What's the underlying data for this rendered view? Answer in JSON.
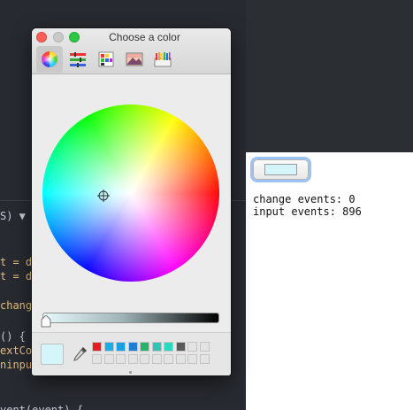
{
  "editor": {
    "lines": [
      {
        "text": "S) ▼",
        "cls": "c-plain"
      },
      {
        "text": "t = do",
        "cls": "c-yellow"
      },
      {
        "text": "t = do",
        "cls": "c-yellow"
      },
      {
        "text": "change",
        "cls": "c-yellow"
      },
      {
        "text": "() {",
        "cls": "c-plain"
      },
      {
        "text": "extCo",
        "cls": "c-yellow"
      },
      {
        "text": "ninpu",
        "cls": "c-yellow"
      },
      {
        "text": "vent(event) {",
        "cls": "c-plain"
      }
    ]
  },
  "browser": {
    "color_input_value": "#d4f6fb",
    "change_events": "change events: 0",
    "input_events": "input events: 896"
  },
  "color_panel": {
    "title": "Choose a color",
    "tools": [
      "color-wheel-icon",
      "color-sliders-icon",
      "color-palettes-icon",
      "image-palettes-icon",
      "crayons-icon"
    ],
    "selected_tool": "color-wheel-icon",
    "brightness_level": 0.01,
    "current_color": "#d4f6fb",
    "swatches": [
      "#e0201f",
      "#1aaee8",
      "#1c9fe0",
      "#1a7fd8",
      "#23b56a",
      "#2ec7b6",
      "#2fd6c0",
      "#595959",
      "#e3e3e3",
      "#e3e3e3"
    ]
  }
}
